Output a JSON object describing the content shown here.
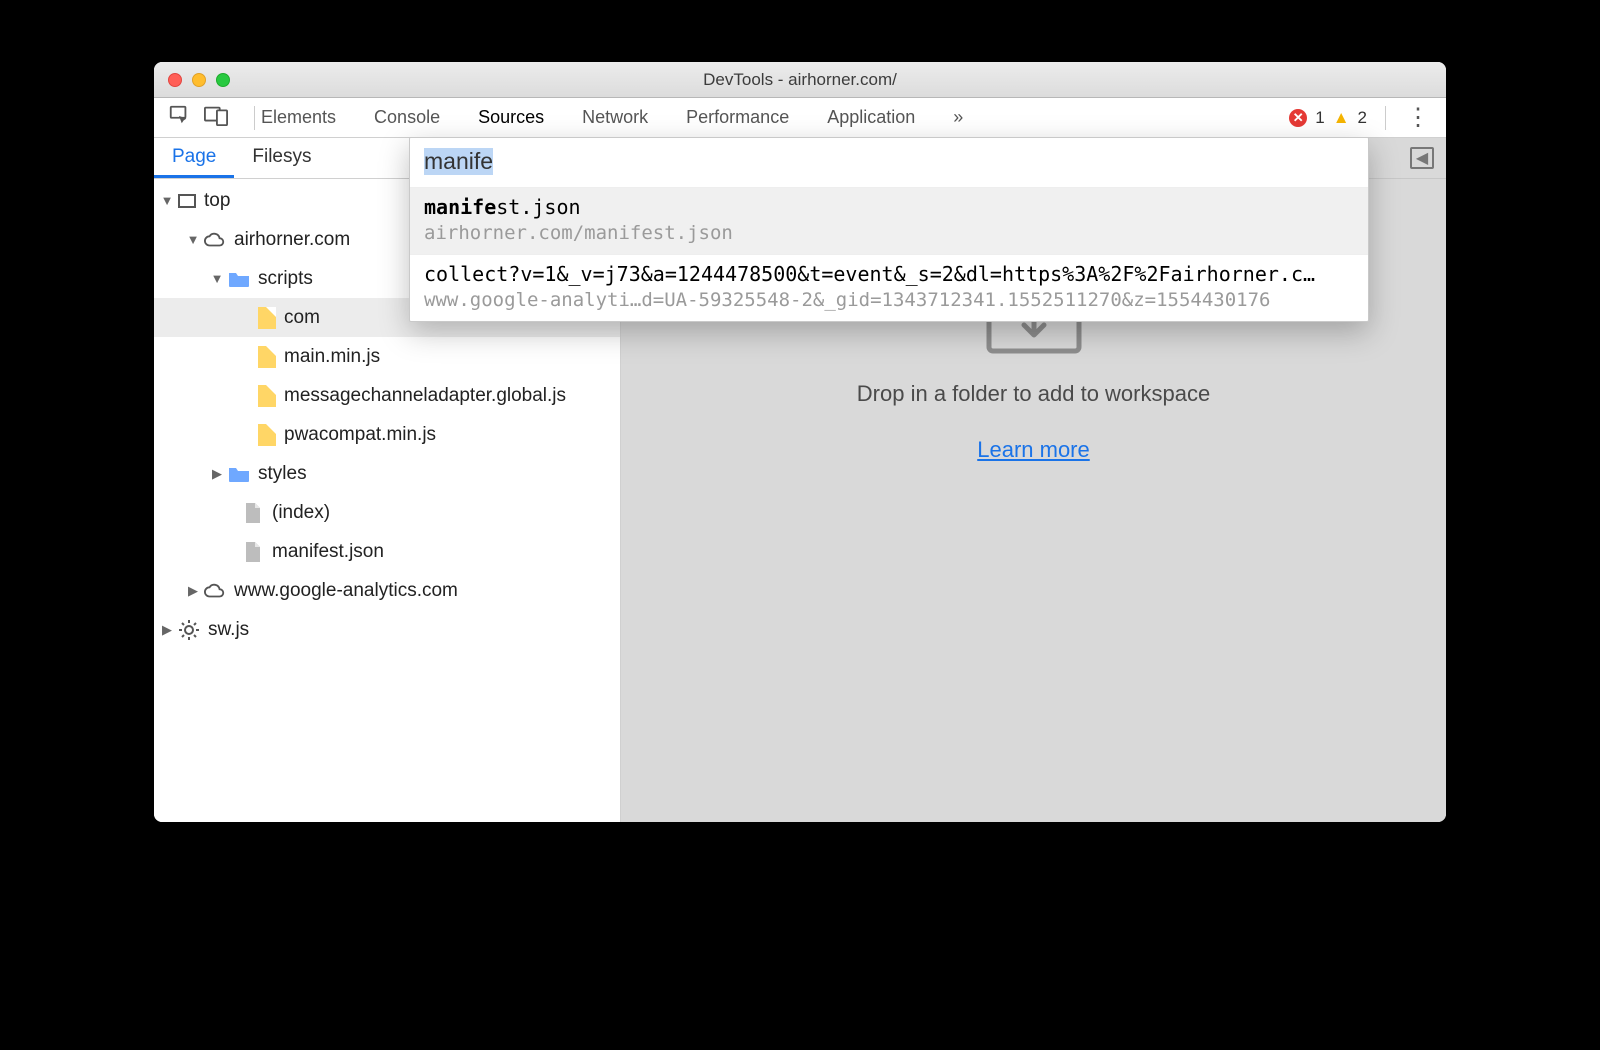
{
  "window": {
    "title": "DevTools - airhorner.com/"
  },
  "tabs": {
    "items": [
      "Elements",
      "Console",
      "Sources",
      "Network",
      "Performance",
      "Application"
    ],
    "active": "Sources",
    "overflow_glyph": "»"
  },
  "status": {
    "errors": 1,
    "warnings": 2
  },
  "subtabs": {
    "items": [
      "Page",
      "Filesys"
    ],
    "active": "Page",
    "second_truncated": "Filesys"
  },
  "tree": {
    "top": "top",
    "domain1": "airhorner.com",
    "folder_scripts": "scripts",
    "files_scripts": [
      "comlink.global.js",
      "main.min.js",
      "messagechanneladapter.global.js",
      "pwacompat.min.js"
    ],
    "scripts_file0_obscured": "com",
    "folder_styles": "styles",
    "root_files": [
      "(index)",
      "manifest.json"
    ],
    "domain2": "www.google-analytics.com",
    "sw": "sw.js"
  },
  "palette": {
    "query": "manife",
    "results": [
      {
        "filename_bold": "manife",
        "filename_rest": "st.json",
        "subtitle": "airhorner.com/manifest.json"
      },
      {
        "filename": "collect?v=1&_v=j73&a=1244478500&t=event&_s=2&dl=https%3A%2F%2Fairhorner.c…",
        "subtitle": "www.google-analyti…d=UA-59325548-2&_gid=1343712341.1552511270&z=1554430176"
      }
    ]
  },
  "panel": {
    "drop_text": "Drop in a folder to add to workspace",
    "learn_more": "Learn more"
  }
}
